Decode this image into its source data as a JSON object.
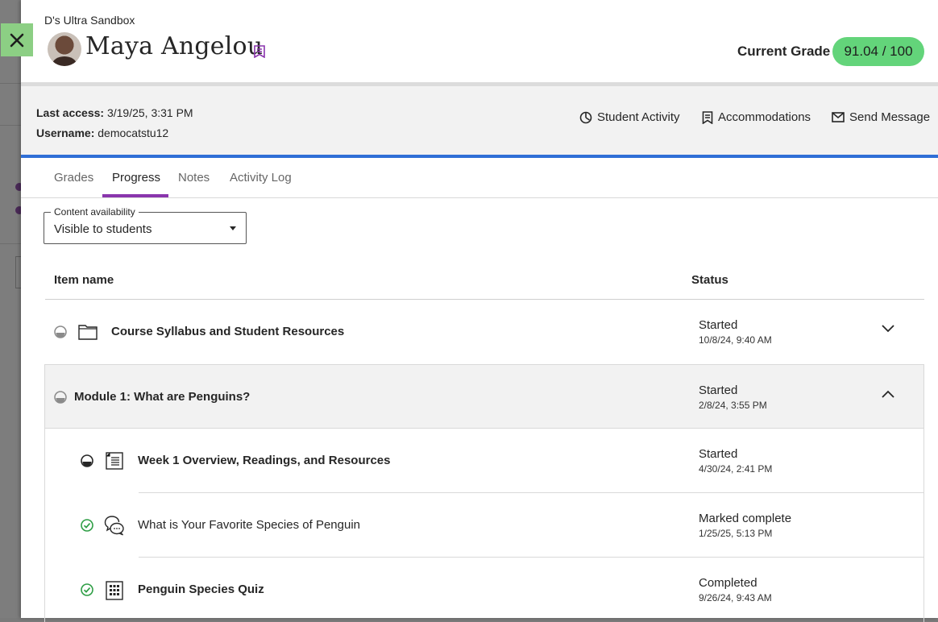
{
  "course": {
    "name": "D's Ultra Sandbox"
  },
  "student": {
    "name": "Maya Angelou",
    "last_access_label": "Last access:",
    "last_access_value": "3/19/25, 3:31 PM",
    "username_label": "Username:",
    "username_value": "democatstu12"
  },
  "grade": {
    "label": "Current Grade",
    "value": "91.04 / 100",
    "color": "#63d47a"
  },
  "actions": {
    "activity": "Student Activity",
    "accommodations": "Accommodations",
    "message": "Send Message"
  },
  "tabs": [
    {
      "label": "Grades"
    },
    {
      "label": "Progress",
      "active": true
    },
    {
      "label": "Notes"
    },
    {
      "label": "Activity Log"
    }
  ],
  "filter": {
    "legend": "Content availability",
    "value": "Visible to students"
  },
  "table": {
    "col_item": "Item name",
    "col_status": "Status",
    "rows": [
      {
        "title": "Course Syllabus and Student Resources",
        "status": "Started",
        "date": "10/8/24, 9:40 AM",
        "progress_icon": "half-progress-icon",
        "type_icon": "folder-icon",
        "expanded": false
      },
      {
        "title": "Module 1: What are Penguins?",
        "status": "Started",
        "date": "2/8/24, 3:55 PM",
        "progress_icon": "half-progress-icon",
        "expanded": true
      },
      {
        "title": "Week 1 Overview, Readings, and Resources",
        "status": "Started",
        "date": "4/30/24, 2:41 PM",
        "progress_icon": "half-progress-icon",
        "type_icon": "document-icon"
      },
      {
        "title": "What is Your Favorite Species of Penguin",
        "status": "Marked complete",
        "date": "1/25/25, 5:13 PM",
        "progress_icon": "check-complete-icon",
        "type_icon": "discussion-icon"
      },
      {
        "title": "Penguin Species Quiz",
        "status": "Completed",
        "date": "9/26/24, 9:43 AM",
        "progress_icon": "check-complete-icon",
        "type_icon": "test-icon"
      }
    ]
  },
  "colors": {
    "accent_purple": "#8a35ad",
    "accent_blue": "#2f6fd6",
    "complete_green": "#2e9e45"
  }
}
